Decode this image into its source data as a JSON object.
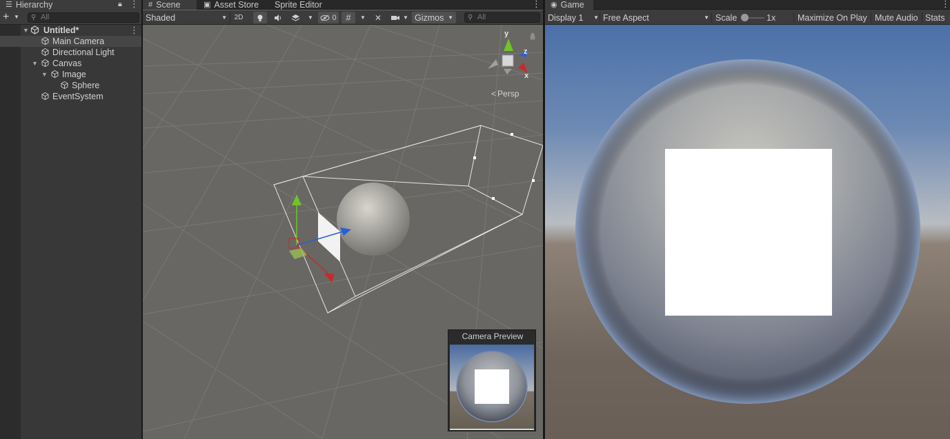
{
  "hierarchy": {
    "tab_label": "Hierarchy",
    "search_placeholder": "All",
    "items": [
      {
        "label": "Untitled*"
      },
      {
        "label": "Main Camera"
      },
      {
        "label": "Directional Light"
      },
      {
        "label": "Canvas"
      },
      {
        "label": "Image"
      },
      {
        "label": "Sphere"
      },
      {
        "label": "EventSystem"
      }
    ]
  },
  "scene": {
    "tabs": [
      {
        "label": "Scene",
        "icon": "grid-icon"
      },
      {
        "label": "Asset Store",
        "icon": "bag-icon"
      },
      {
        "label": "Sprite Editor"
      }
    ],
    "toolbar": {
      "shading_mode": "Shaded",
      "mode_2d": "2D",
      "hidden_count": "0",
      "gizmos": "Gizmos",
      "search_placeholder": "All"
    },
    "gizmo": {
      "y": "y",
      "z": "z",
      "x": "x",
      "projection": "Persp"
    },
    "camera_preview_title": "Camera Preview"
  },
  "game": {
    "tab_label": "Game",
    "display": "Display 1",
    "aspect": "Free Aspect",
    "scale_label": "Scale",
    "scale_value": "1x",
    "maximize": "Maximize On Play",
    "mute": "Mute Audio",
    "stats": "Stats"
  },
  "colors": {
    "accent_axis_x": "#c42b2b",
    "accent_axis_y": "#6fc428",
    "accent_axis_z": "#2a5fd6"
  }
}
